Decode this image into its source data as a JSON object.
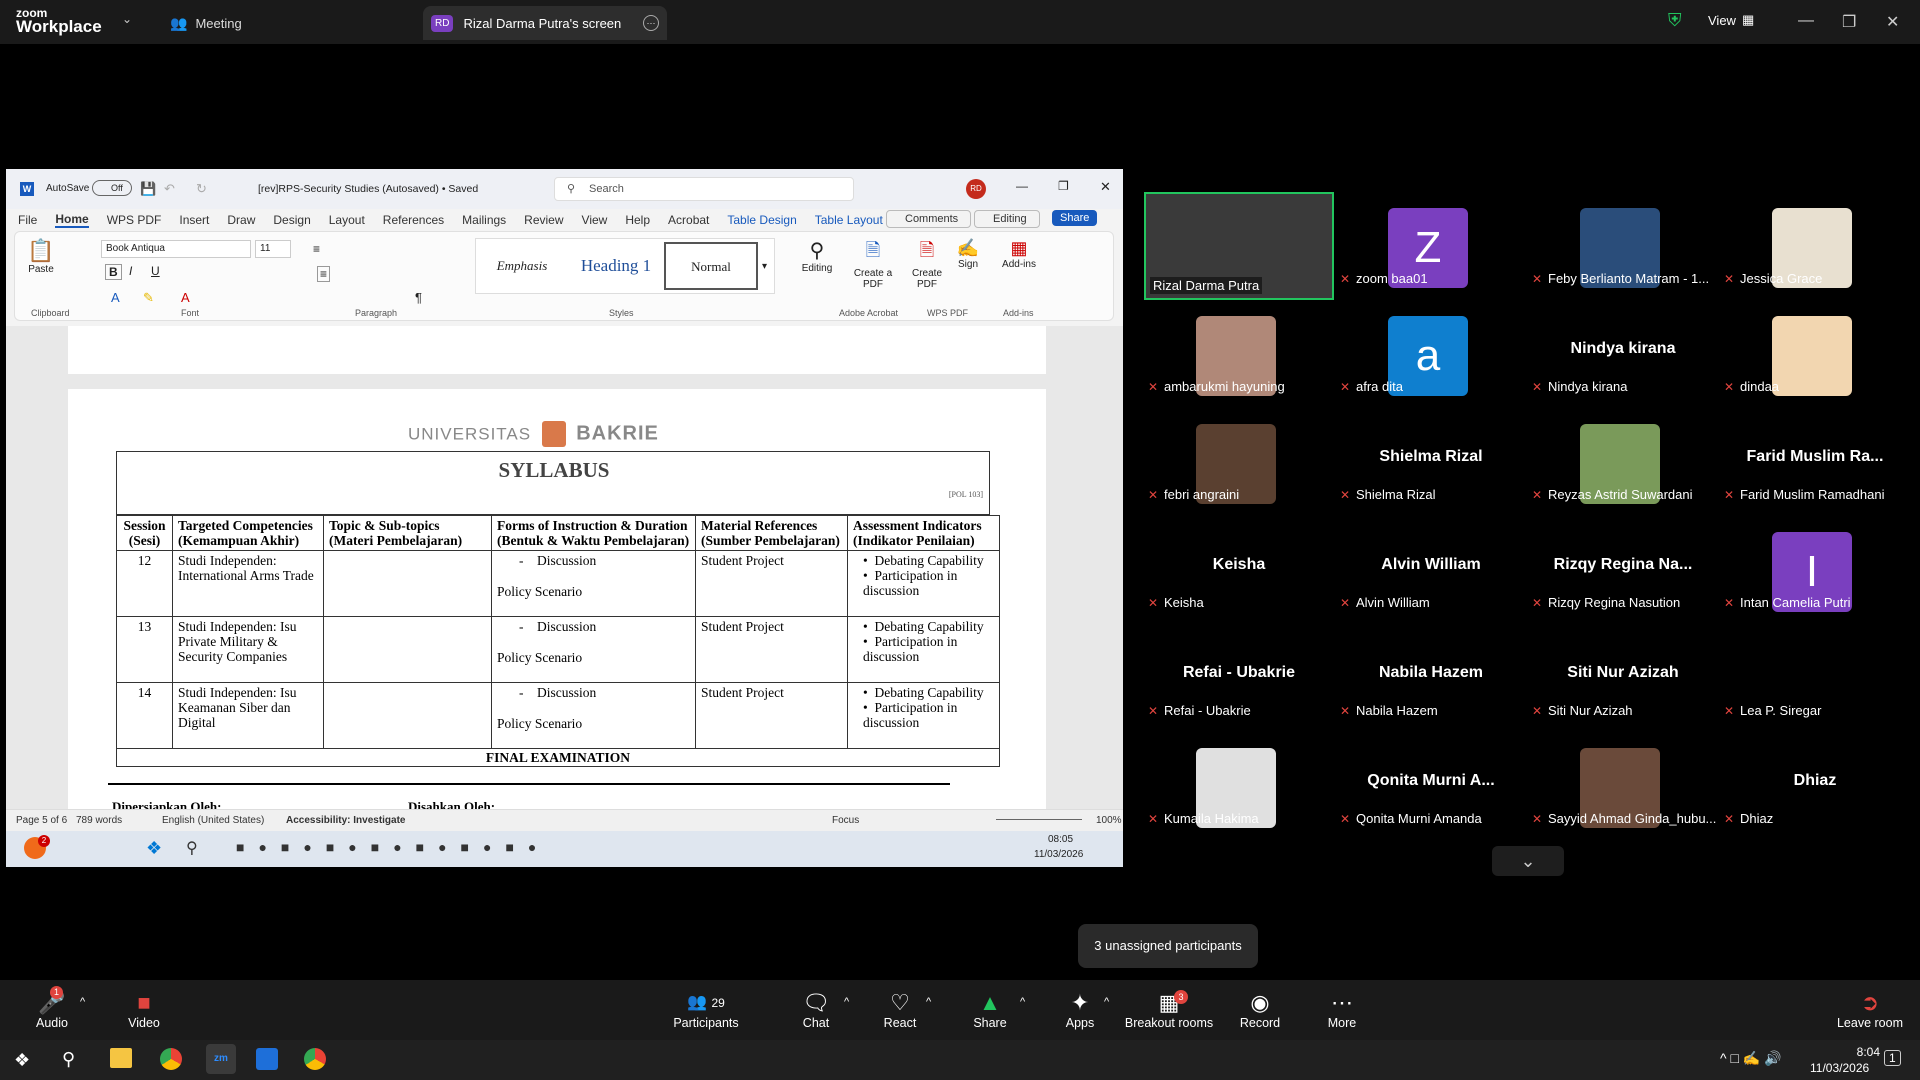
{
  "zoom": {
    "brand_top": "zoom",
    "brand_bottom": "Workplace",
    "meeting_tab": "Meeting",
    "screen_tab_initials": "RD",
    "screen_tab": "Rizal Darma Putra's screen",
    "view_label": "View",
    "unassigned": "3 unassigned participants"
  },
  "word": {
    "autosave": "AutoSave",
    "autosave_state": "Off",
    "doc_title": "[rev]RPS-Security Studies (Autosaved) • Saved",
    "search_placeholder": "Search",
    "user_initials": "RD",
    "menu": [
      "File",
      "Home",
      "WPS PDF",
      "Insert",
      "Draw",
      "Design",
      "Layout",
      "References",
      "Mailings",
      "Review",
      "View",
      "Help",
      "Acrobat",
      "Table Design",
      "Table Layout"
    ],
    "comments": "Comments",
    "editing": "Editing",
    "share": "Share",
    "font_name": "Book Antiqua",
    "font_size": "11",
    "paste": "Paste",
    "styles": [
      "Emphasis",
      "Heading 1",
      "Normal"
    ],
    "editing_btn": "Editing",
    "create_pdf": "Create a PDF",
    "create_pdf2": "Create PDF",
    "sign": "Sign",
    "addins": "Add-ins",
    "groups": [
      "Clipboard",
      "Font",
      "Paragraph",
      "Styles",
      "Adobe Acrobat",
      "WPS PDF",
      "Add-ins"
    ],
    "univ_left": "UNIVERSITAS",
    "univ_right": "BAKRIE",
    "syllabus_title": "SYLLABUS",
    "doc_code": "[POL 103]",
    "headers": [
      [
        "Session",
        "(Sesi)"
      ],
      [
        "Targeted Competencies",
        "(Kemampuan Akhir)"
      ],
      [
        "Topic & Sub-topics",
        "(Materi Pembelajaran)"
      ],
      [
        "Forms of Instruction & Duration",
        "(Bentuk & Waktu Pembelajaran)"
      ],
      [
        "Material References",
        "(Sumber Pembelajaran)"
      ],
      [
        "Assessment Indicators",
        "(Indikator Penilaian)"
      ]
    ],
    "rows": [
      {
        "session": "12",
        "competency": "Studi Independen: International Arms Trade",
        "topic": "",
        "form_a": "Discussion",
        "form_b": "Policy Scenario",
        "ref": "Student Project",
        "ind_a": "Debating Capability",
        "ind_b": "Participation in discussion"
      },
      {
        "session": "13",
        "competency": "Studi Independen: Isu Private Military & Security Companies",
        "topic": "",
        "form_a": "Discussion",
        "form_b": "Policy Scenario",
        "ref": "Student Project",
        "ind_a": "Debating Capability",
        "ind_b": "Participation in discussion"
      },
      {
        "session": "14",
        "competency": "Studi Independen: Isu Keamanan Siber dan Digital",
        "topic": "",
        "form_a": "Discussion",
        "form_b": "Policy Scenario",
        "ref": "Student Project",
        "ind_a": "Debating Capability",
        "ind_b": "Participation in discussion"
      }
    ],
    "final_exam": "FINAL EXAMINATION",
    "prepared_by": "Dipersiapkan Oleh:",
    "approved_by": "Disahkan Oleh:",
    "status_page": "Page 5 of 6",
    "status_words": "789 words",
    "status_lang": "English (United States)",
    "status_access": "Accessibility: Investigate",
    "status_focus": "Focus",
    "status_zoom": "100%",
    "inner_time": "08:05",
    "inner_date": "11/03/2026",
    "inner_badge": "2"
  },
  "participants": [
    {
      "name": "Rizal Darma Putra",
      "big": "",
      "muted": false,
      "color": "#2d2d2d"
    },
    {
      "name": "zoom baa01",
      "big": "Z",
      "muted": true,
      "color": "#7a3fbf"
    },
    {
      "name": "Feby Berlianto Matram - 1...",
      "big": "",
      "muted": true,
      "color": "#2a4d7a"
    },
    {
      "name": "Jessica Grace",
      "big": "",
      "muted": true,
      "color": "#e8e0d0"
    },
    {
      "name": "ambarukmi hayuning",
      "big": "",
      "muted": true,
      "color": "#b08878"
    },
    {
      "name": "afra dita",
      "big": "a",
      "muted": true,
      "color": "#0f7fcf"
    },
    {
      "name": "Nindya kirana",
      "big": "Nindya kirana",
      "muted": true,
      "color": ""
    },
    {
      "name": "dindaa",
      "big": "",
      "muted": true,
      "color": "#f2d6b0"
    },
    {
      "name": "febri angraini",
      "big": "",
      "muted": true,
      "color": "#5a4030"
    },
    {
      "name": "Shielma Rizal",
      "big": "Shielma Rizal",
      "muted": true,
      "color": ""
    },
    {
      "name": "Reyzas Astrid Suwardani",
      "big": "",
      "muted": true,
      "color": "#7a9a5a"
    },
    {
      "name": "Farid Muslim Ramadhani",
      "big": "Farid Muslim Ra...",
      "muted": true,
      "color": ""
    },
    {
      "name": "Keisha",
      "big": "Keisha",
      "muted": true,
      "color": ""
    },
    {
      "name": "Alvin William",
      "big": "Alvin William",
      "muted": true,
      "color": ""
    },
    {
      "name": "Rizqy Regina Nasution",
      "big": "Rizqy Regina Na...",
      "muted": true,
      "color": ""
    },
    {
      "name": "Intan Camelia Putri",
      "big": "I",
      "muted": true,
      "color": "#7a3fbf"
    },
    {
      "name": "Refai - Ubakrie",
      "big": "Refai - Ubakrie",
      "muted": true,
      "color": ""
    },
    {
      "name": "Nabila Hazem",
      "big": "Nabila Hazem",
      "muted": true,
      "color": ""
    },
    {
      "name": "Siti Nur Azizah",
      "big": "Siti Nur Azizah",
      "muted": true,
      "color": ""
    },
    {
      "name": "Lea P. Siregar",
      "big": "",
      "muted": true,
      "color": "#000000"
    },
    {
      "name": "Kumaila Hakima",
      "big": "",
      "muted": true,
      "color": "#e0e0e0"
    },
    {
      "name": "Qonita Murni Amanda",
      "big": "Qonita Murni A...",
      "muted": true,
      "color": ""
    },
    {
      "name": "Sayyid Ahmad Ginda_hubu...",
      "big": "",
      "muted": true,
      "color": "#6a4a3a"
    },
    {
      "name": "Dhiaz",
      "big": "Dhiaz",
      "muted": true,
      "color": ""
    }
  ],
  "toolbar": {
    "audio": "Audio",
    "audio_badge": "1",
    "video": "Video",
    "participants": "Participants",
    "participants_count": "29",
    "chat": "Chat",
    "react": "React",
    "share": "Share",
    "apps": "Apps",
    "breakout": "Breakout rooms",
    "breakout_badge": "3",
    "record": "Record",
    "more": "More",
    "leave": "Leave room"
  },
  "os": {
    "time": "8:04",
    "date": "11/03/2026",
    "notif": "1"
  }
}
